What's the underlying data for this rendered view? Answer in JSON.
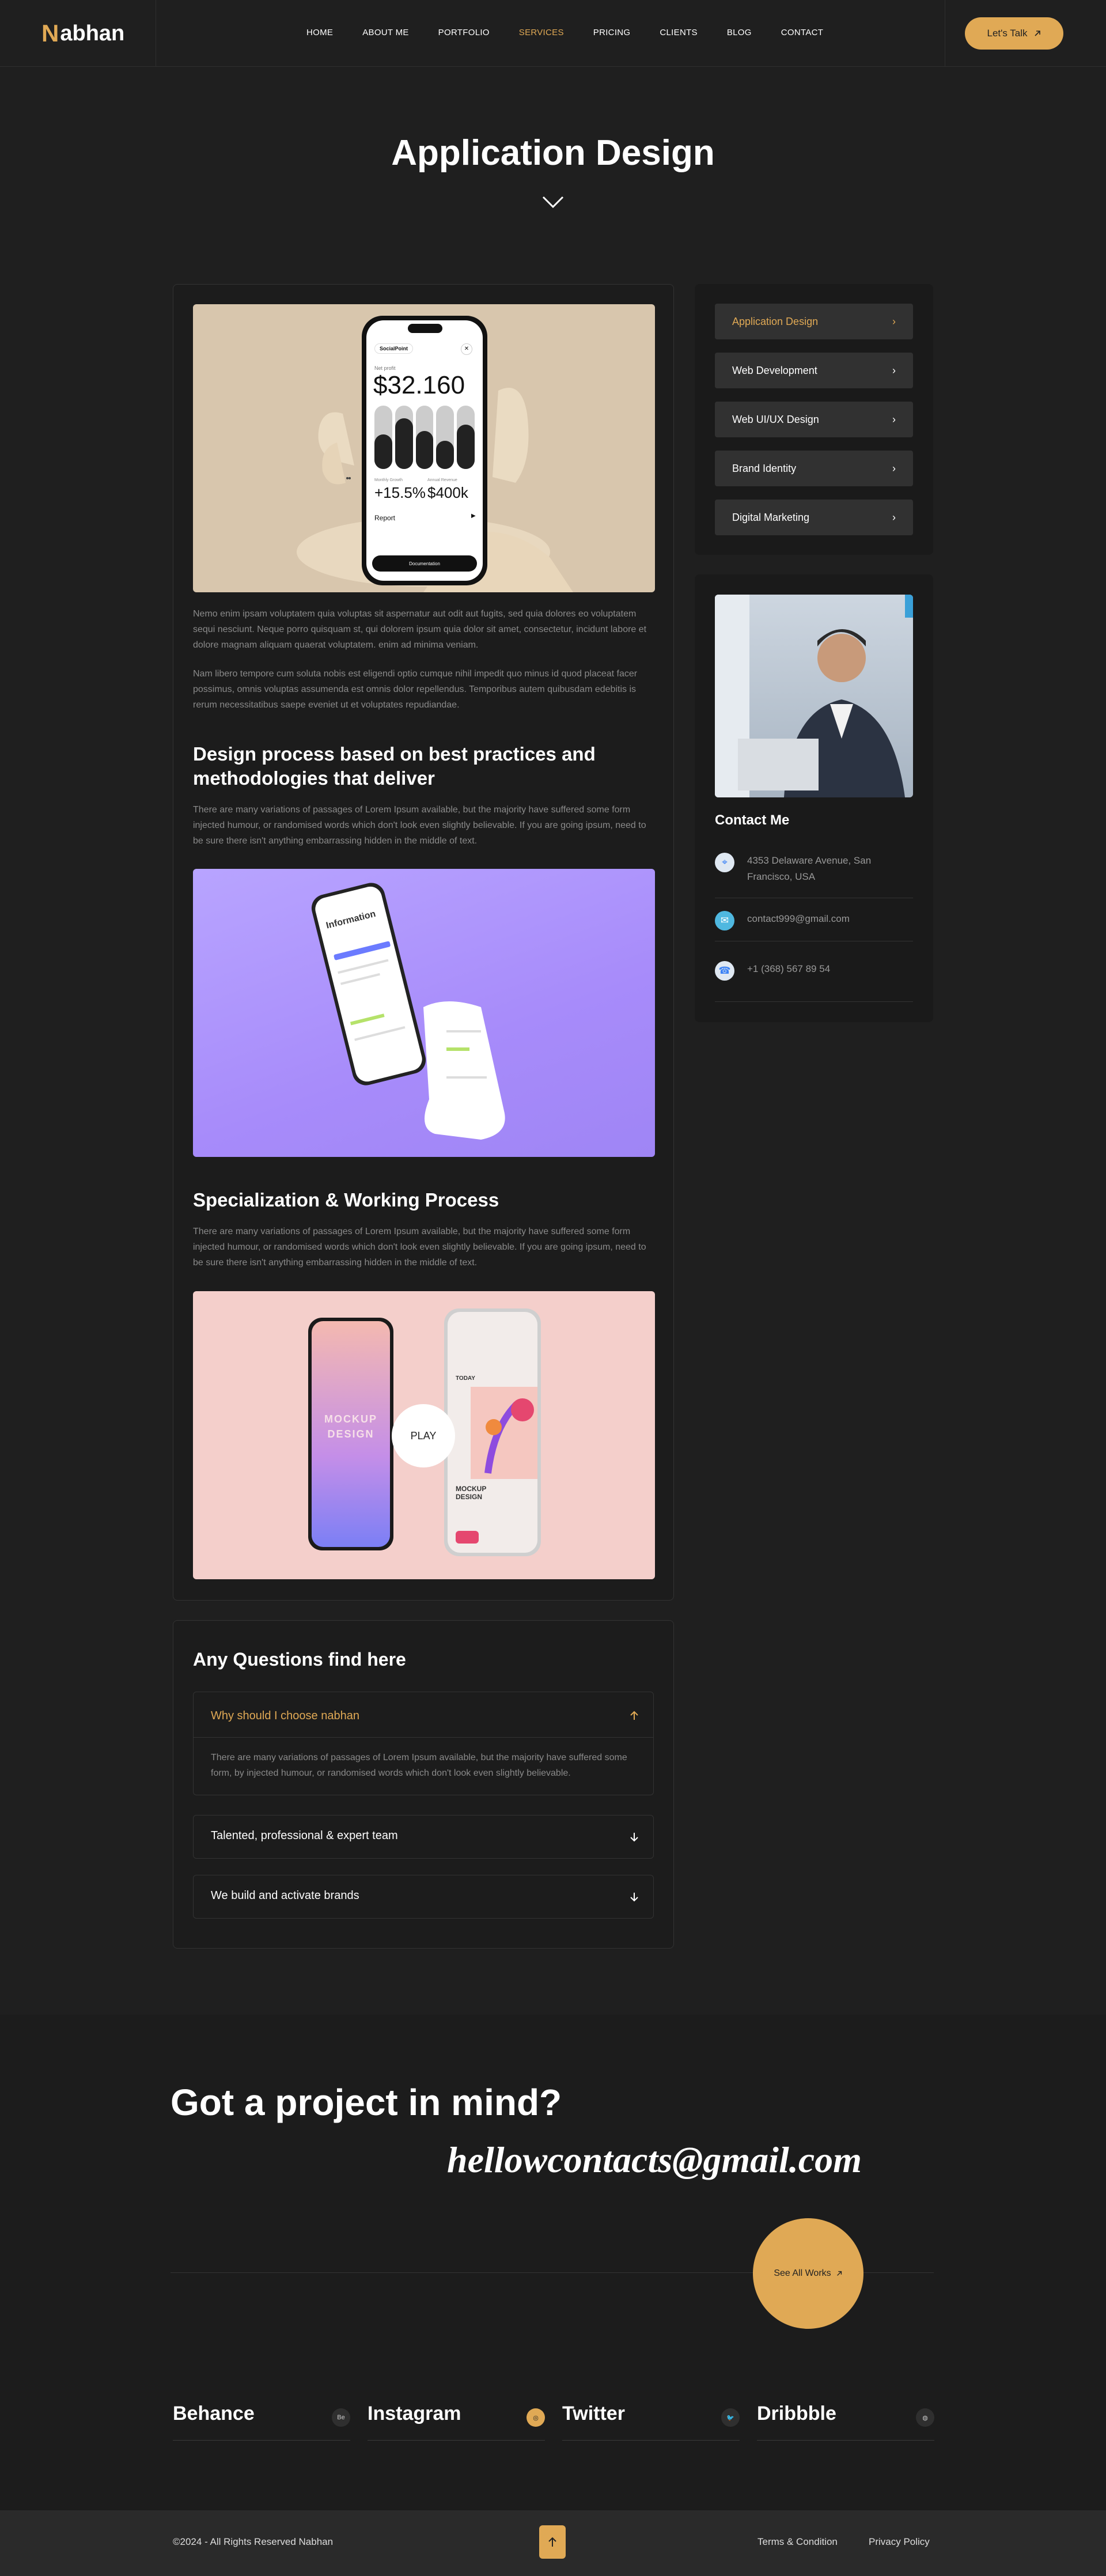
{
  "header": {
    "logo_letter": "N",
    "logo_rest": "abhan",
    "nav": [
      "HOME",
      "ABOUT ME",
      "PORTFOLIO",
      "SERVICES",
      "PRICING",
      "CLIENTS",
      "BLOG",
      "CONTACT"
    ],
    "active_nav": "SERVICES",
    "cta_label": "Let's Talk"
  },
  "hero": {
    "title": "Application Design"
  },
  "main": {
    "phone1": {
      "brand": "SocialPoint",
      "label": "Net profit",
      "amount": "$32.160",
      "stat1_label": "Monthly Growth",
      "stat1": "+15.5%",
      "stat2_label": "Annual Revenue",
      "stat2": "$400k",
      "report": "Report",
      "pill": "Documentation"
    },
    "para1": "Nemo enim ipsam voluptatem quia voluptas sit aspernatur aut odit aut fugits, sed quia dolores eo voluptatem sequi nesciunt. Neque porro quisquam st, qui dolorem ipsum quia dolor sit amet, consectetur, incidunt labore et dolore magnam aliquam quaerat voluptatem. enim ad minima veniam.",
    "para2": "Nam libero tempore cum soluta nobis est eligendi optio cumque nihil impedit quo minus id quod placeat facer possimus, omnis voluptas assumenda est omnis dolor repellendus. Temporibus autem quibusdam edebitis is rerum necessitatibus saepe eveniet ut et voluptates repudiandae.",
    "heading1": "Design process based on best practices and methodologies that deliver",
    "para3": "There are many variations of passages of Lorem Ipsum available, but the majority have suffered some form injected humour, or randomised words which don't look even slightly believable. If you are going ipsum, need to be sure there isn't anything embarrassing hidden in the middle of text.",
    "phone2_title": "Information",
    "heading2": "Specialization & Working Process",
    "para4": "There are many variations of passages of Lorem Ipsum available, but the majority have suffered some form injected humour, or randomised words which don't look even slightly believable. If you are going ipsum, need to be sure there isn't anything embarrassing hidden in the middle of text.",
    "mockup_text1": "MOCKUP",
    "mockup_text2": "DESIGN",
    "mockup_today": "TODAY",
    "mockup_small1": "MOCKUP",
    "mockup_small2": "DESIGN",
    "play_label": "PLAY"
  },
  "sidebar": {
    "services": [
      {
        "label": "Application Design",
        "active": true
      },
      {
        "label": "Web Development",
        "active": false
      },
      {
        "label": "Web UI/UX Design",
        "active": false
      },
      {
        "label": "Brand Identity",
        "active": false
      },
      {
        "label": "Digital Marketing",
        "active": false
      }
    ],
    "contact_title": "Contact Me",
    "address": "4353 Delaware Avenue, San Francisco, USA",
    "email": "contact999@gmail.com",
    "phone": "+1 (368) 567 89 54"
  },
  "faq": {
    "title": "Any Questions find here",
    "items": [
      {
        "q": "Why should I choose nabhan",
        "a": "There are many variations of passages of Lorem Ipsum available, but the majority have suffered some form, by injected humour, or randomised words which don't look even slightly believable.",
        "open": true
      },
      {
        "q": "Talented, professional & expert team",
        "open": false
      },
      {
        "q": "We build and activate brands",
        "open": false
      }
    ]
  },
  "cta": {
    "title": "Got a project in mind?",
    "email": "hellowcontacts@gmail.com",
    "button": "See All Works"
  },
  "socials": [
    {
      "name": "Behance",
      "icon": "Be"
    },
    {
      "name": "Instagram",
      "icon": "◎"
    },
    {
      "name": "Twitter",
      "icon": "🐦"
    },
    {
      "name": "Dribbble",
      "icon": "◍"
    }
  ],
  "footer": {
    "copyright": "©2024 - All Rights Reserved Nabhan",
    "links": [
      "Terms & Condition",
      "Privacy Policy"
    ]
  },
  "colors": {
    "accent": "#e0a955",
    "bg": "#1f1f1f",
    "card": "#1c1c1c"
  }
}
